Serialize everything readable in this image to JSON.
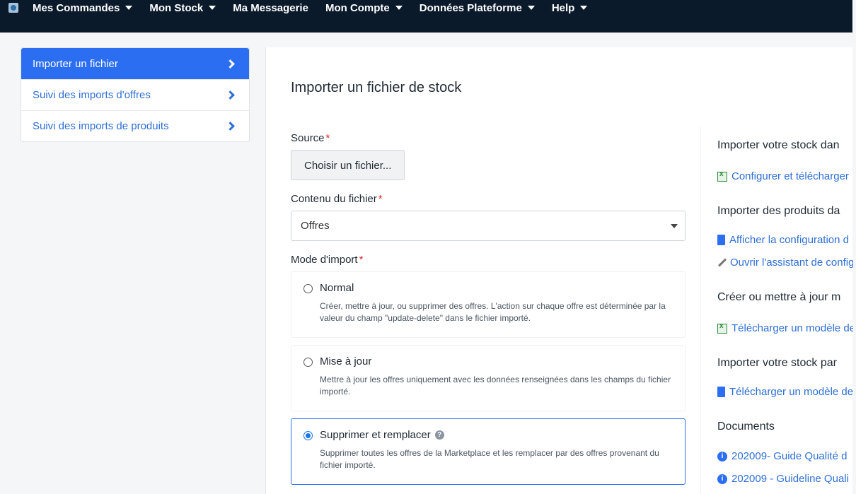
{
  "nav": {
    "items": [
      {
        "label": "Mes Commandes",
        "dropdown": true
      },
      {
        "label": "Mon Stock",
        "dropdown": true
      },
      {
        "label": "Ma Messagerie",
        "dropdown": false
      },
      {
        "label": "Mon Compte",
        "dropdown": true
      },
      {
        "label": "Données Plateforme",
        "dropdown": true
      },
      {
        "label": "Help",
        "dropdown": true
      }
    ]
  },
  "sidebar": {
    "items": [
      {
        "label": "Importer un fichier",
        "active": true
      },
      {
        "label": "Suivi des imports d'offres",
        "active": false
      },
      {
        "label": "Suivi des imports de produits",
        "active": false
      }
    ]
  },
  "main": {
    "title": "Importer un fichier de stock",
    "source_label": "Source",
    "required_mark": "*",
    "file_button": "Choisir un fichier...",
    "content_label": "Contenu du fichier",
    "content_value": "Offres",
    "mode_label": "Mode d'import",
    "modes": [
      {
        "title": "Normal",
        "desc": "Créer, mettre à jour, ou supprimer des offres. L'action sur chaque offre est déterminée par la valeur du champ \"update-delete\" dans le fichier importé.",
        "selected": false
      },
      {
        "title": "Mise à jour",
        "desc": "Mettre à jour les offres uniquement avec les données renseignées dans les champs du fichier importé.",
        "selected": false
      },
      {
        "title": "Supprimer et remplacer",
        "desc": "Supprimer toutes les offres de la Marketplace et les remplacer par des offres provenant du fichier importé.",
        "selected": true
      }
    ]
  },
  "right": {
    "h1": "Importer votre stock dan",
    "l1": "Configurer et télécharger",
    "h2": "Importer des produits da",
    "l2": "Afficher la configuration d",
    "l3": "Ouvrir l'assistant de config",
    "h3": "Créer ou mettre à jour m",
    "l4": "Télécharger un modèle de",
    "h4": "Importer votre stock par",
    "l5": "Télécharger un modèle de",
    "h5": "Documents",
    "l6": "202009- Guide Qualité d",
    "l7": "202009 - Guideline Quali"
  },
  "colors": {
    "navbar": "#0b1a2b",
    "accent": "#2b6ef2",
    "link": "#2e6fd6",
    "required": "#d32f2f"
  }
}
